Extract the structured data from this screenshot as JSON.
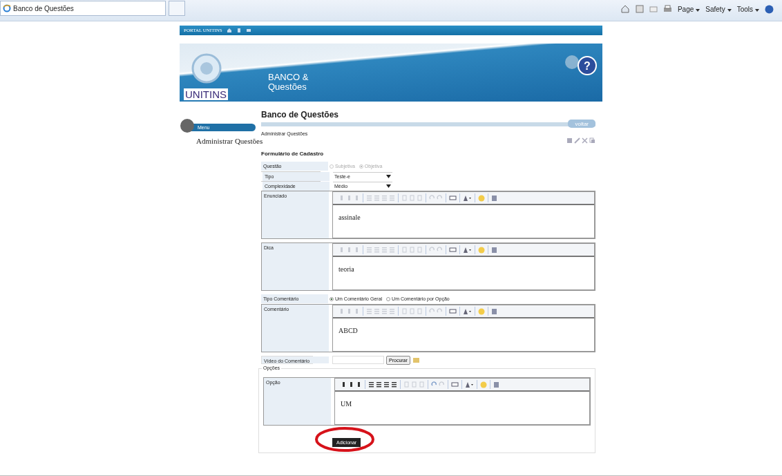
{
  "browser": {
    "tabs": [
      {
        "title": "Banco de Questões",
        "selected": true
      }
    ],
    "commands": [
      "Page",
      "Safety",
      "Tools"
    ]
  },
  "portal_bar": {
    "label": "PORTAL UNITINS"
  },
  "banner": {
    "help_glyph": "?",
    "logo": "UNITINS",
    "title_line_1": "BANCO &",
    "title_line_2": "Questões"
  },
  "sidebar": {
    "heading": "Menu",
    "items": [
      {
        "label": "Administrar Questões"
      }
    ]
  },
  "page": {
    "title": "Banco de Questões",
    "back_button": "voltar",
    "breadcrumb": "Administrar Questões"
  },
  "form": {
    "title": "Formulário de Cadastro",
    "fields": [
      {
        "kind": "radio",
        "label": "Questão",
        "disabled": true,
        "options": [
          {
            "label": "Subjetiva",
            "selected": false
          },
          {
            "label": "Objetiva",
            "selected": true
          }
        ]
      },
      {
        "kind": "select",
        "label": "Tipo",
        "value": "Teste-e"
      },
      {
        "kind": "select",
        "label": "Complexidade",
        "value": "Médio"
      },
      {
        "kind": "editor",
        "label": "Enunciado",
        "value": "assinale",
        "toolbar_active": false
      },
      {
        "kind": "editor",
        "label": "Dica",
        "value": "teoria",
        "toolbar_active": false
      },
      {
        "kind": "radio",
        "label": "Tipo Comentário",
        "disabled": false,
        "options": [
          {
            "label": "Um Comentário Geral",
            "selected": true
          },
          {
            "label": "Um Comentário por Opção",
            "selected": false
          }
        ]
      },
      {
        "kind": "editor",
        "label": "Comentário",
        "value": "ABCD",
        "toolbar_active": false
      },
      {
        "kind": "file",
        "label": "Vídeo do Comentário",
        "button": "Procurar"
      }
    ]
  },
  "options_group": {
    "legend": "Opções",
    "fields": [
      {
        "kind": "editor",
        "label": "Opção",
        "value": "UM",
        "toolbar_active": true
      }
    ]
  },
  "add_button": {
    "label": "Adicionar",
    "highlighted": true
  }
}
